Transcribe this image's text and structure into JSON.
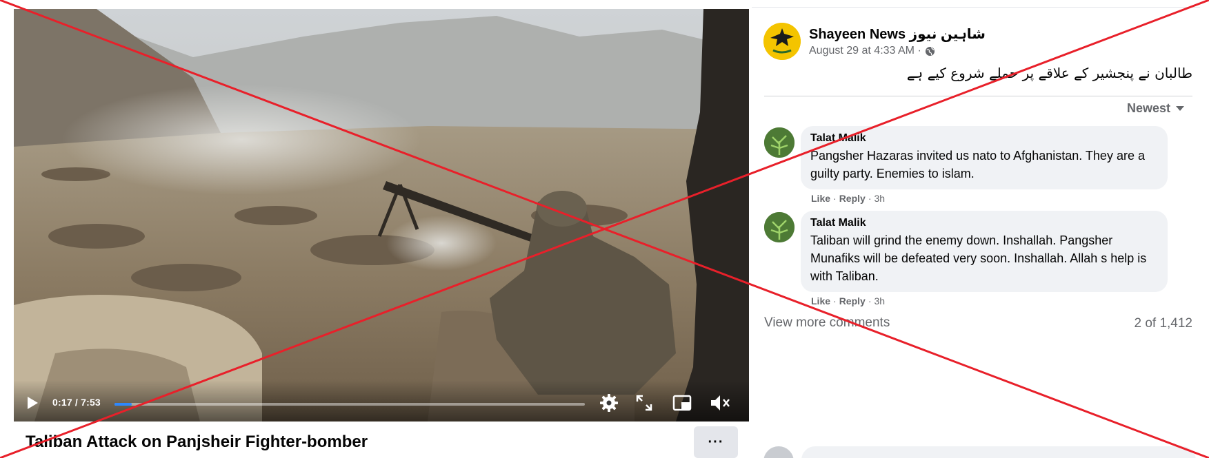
{
  "video": {
    "time_display": "0:17 / 7:53",
    "progress": 0.036,
    "title": "Taliban Attack on Panjsheir Fighter-bomber",
    "more_label": "···"
  },
  "post": {
    "page_name": "Shayeen News شاہین نیوز",
    "date": "August 29 at 4:33 AM ·",
    "text": "طالبان نے پنجشیر کے علاقے پر حملے شروع کیے ہے"
  },
  "comments": {
    "sort_label": "Newest",
    "items": [
      {
        "author": "Talat Malik",
        "text": "Pangsher Hazaras invited us nato to Afghanistan. They are a guilty party. Enemies to islam.",
        "like": "Like",
        "reply": "Reply",
        "time": "3h"
      },
      {
        "author": "Talat Malik",
        "text": "Taliban will grind the enemy down. Inshallah. Pangsher Munafiks will be defeated very soon. Inshallah. Allah s help is with Taliban.",
        "like": "Like",
        "reply": "Reply",
        "time": "3h"
      }
    ],
    "view_more": "View more comments",
    "count": "2 of 1,412"
  },
  "colors": {
    "overlay_cross": "#e8202a",
    "progress": "#2d88ff",
    "secondary_text": "#65676b",
    "bubble": "#f0f2f5"
  }
}
